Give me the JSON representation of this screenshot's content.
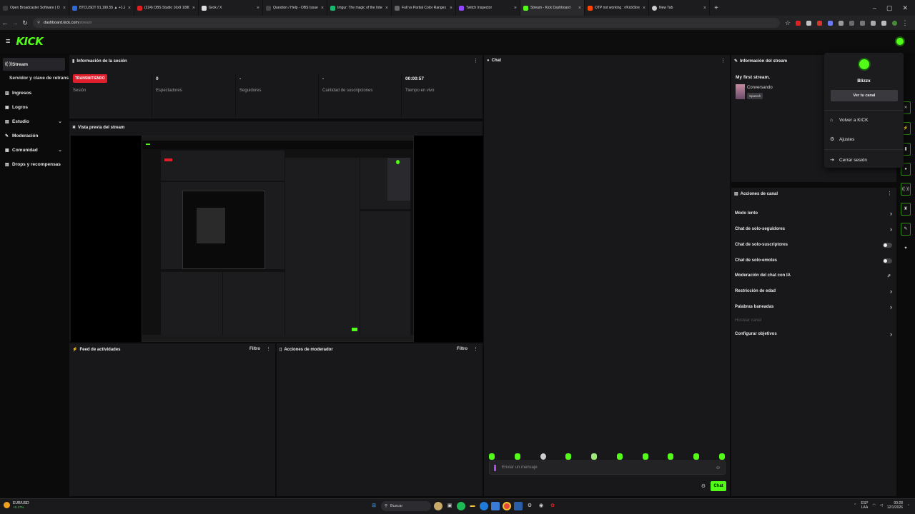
{
  "browser": {
    "tabs": [
      {
        "title": "Open Broadcaster Software | O",
        "color": "#3a3a3a"
      },
      {
        "title": "BTCUSDT 91,190.55 ▲ +1.29%",
        "color": "#2a6bd8"
      },
      {
        "title": "(224) OBS Studio 16x9 1080p ...",
        "color": "#e02020"
      },
      {
        "title": "Grok / X",
        "color": "#dddddd"
      },
      {
        "title": "Question / Help - OBS Issue -",
        "color": "#444444"
      },
      {
        "title": "Imgur: The magic of the Intern",
        "color": "#1bb76e"
      },
      {
        "title": "Full vs Partial Color Ranges [OB",
        "color": "#666666"
      },
      {
        "title": "Twitch Inspector",
        "color": "#9146ff"
      },
      {
        "title": "Stream - Kick Dashboard",
        "color": "#53fc18"
      },
      {
        "title": "OTP not working : r/KickStream",
        "color": "#ff4500"
      },
      {
        "title": "New Tab",
        "color": "#cccccc"
      }
    ],
    "new_tab": "+",
    "url_host": "dashboard.kick.com",
    "url_path": "/stream"
  },
  "header": {
    "menu_icon": "≡",
    "logo": "KICK"
  },
  "sidebar": {
    "items": [
      {
        "label": "Stream",
        "icon": "((·))",
        "active": true
      },
      {
        "label": "Ingresos",
        "icon": "▥"
      },
      {
        "label": "Logros",
        "icon": "▣"
      },
      {
        "label": "Estudio",
        "icon": "▤",
        "chevron": "⌄"
      },
      {
        "label": "Moderación",
        "icon": "✎"
      },
      {
        "label": "Comunidad",
        "icon": "▦",
        "chevron": "⌄"
      },
      {
        "label": "Drops y recompensas",
        "icon": "▧"
      }
    ],
    "sub_item": "Servidor y clave de retransmisión"
  },
  "session": {
    "title": "Información de la sesión",
    "live_badge": "TRANSMITIENDO",
    "stats": [
      {
        "value": "",
        "label": "Sesión"
      },
      {
        "value": "0",
        "label": "Espectadores"
      },
      {
        "value": "-",
        "label": "Seguidores"
      },
      {
        "value": "-",
        "label": "Cantidad de suscripciones"
      },
      {
        "value": "00:00:57",
        "label": "Tiempo en vivo"
      }
    ]
  },
  "preview": {
    "title": "Vista previa del stream"
  },
  "activity": {
    "title": "Feed de actividades",
    "filter": "Filtro"
  },
  "modactions": {
    "title": "Acciones de moderador",
    "filter": "Filtro"
  },
  "chat": {
    "title": "Chat",
    "placeholder": "Enviar un mensaje",
    "send": "Chat"
  },
  "stream_info": {
    "title": "Información del stream",
    "stream_title": "My first stream.",
    "category": "Conversando",
    "language": "Spanish"
  },
  "channel_actions": {
    "title": "Acciones de canal",
    "items": [
      {
        "label": "Modo lento",
        "control": "chevron"
      },
      {
        "label": "Chat de solo-seguidores",
        "control": "chevron"
      },
      {
        "label": "Chat de solo-suscriptores",
        "control": "toggle"
      },
      {
        "label": "Chat de solo-emotes",
        "control": "toggle"
      },
      {
        "label": "Moderación del chat con IA",
        "control": "external"
      },
      {
        "label": "Restricción de edad",
        "control": "chevron"
      },
      {
        "label": "Palabras baneadas",
        "control": "chevron"
      },
      {
        "label": "Hostear canal",
        "control": "disabled"
      },
      {
        "label": "Configurar objetivos",
        "control": "chevron"
      }
    ]
  },
  "user_menu": {
    "username": "Blizzx",
    "view_channel": "Ver tu canal",
    "items": [
      {
        "label": "Volver a KICK",
        "icon": "⌂"
      },
      {
        "label": "Ajustes",
        "icon": "⚙"
      },
      {
        "label": "Cerrar sesión",
        "icon": "⇥"
      }
    ]
  },
  "taskbar": {
    "ticker": "EUR/USD",
    "ticker_change": "+0.17%",
    "search": "Buscar",
    "lang_top": "ESP",
    "lang_bottom": "LAA",
    "time": "00:28",
    "date": "12/1/2026"
  },
  "colors": {
    "accent": "#53fc18",
    "live": "#e11e2b",
    "panel": "#18181a"
  }
}
